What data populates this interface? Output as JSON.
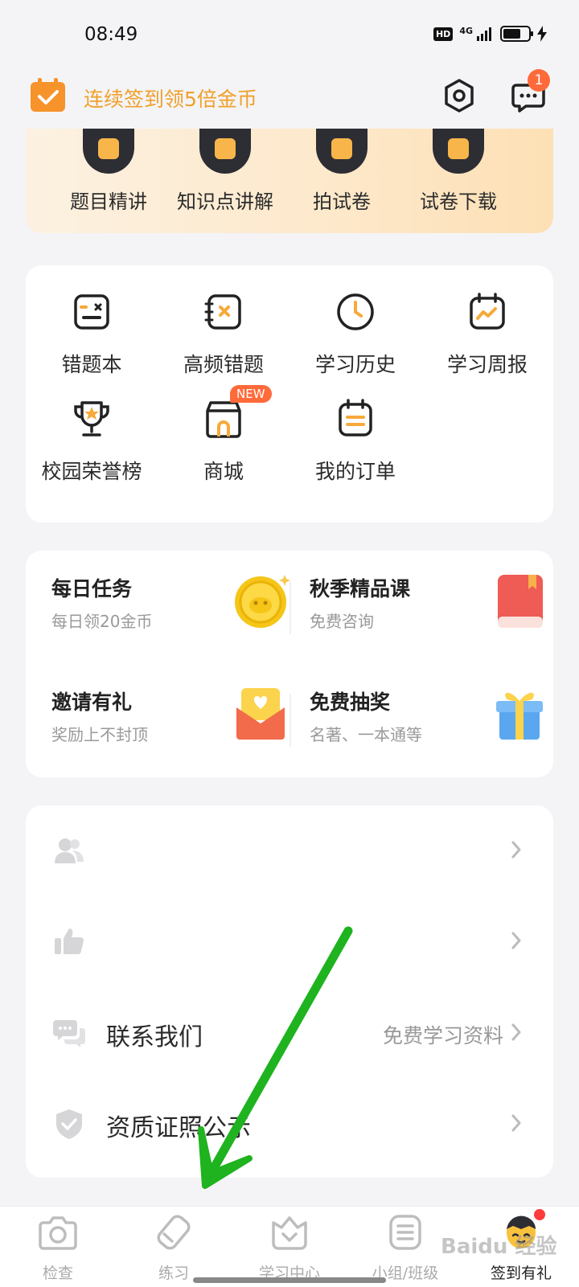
{
  "status": {
    "time": "08:49",
    "hd": "HD",
    "network": "4G"
  },
  "header": {
    "checkin_text": "连续签到领5倍金币",
    "message_badge": "1"
  },
  "promo": {
    "items": [
      {
        "label": "题目精讲",
        "icon": "play-icon"
      },
      {
        "label": "知识点讲解",
        "icon": "notes-icon"
      },
      {
        "label": "拍试卷",
        "icon": "printer-icon"
      },
      {
        "label": "试卷下载",
        "icon": "download-icon"
      }
    ]
  },
  "tools": {
    "items": [
      {
        "label": "错题本",
        "icon": "wrong-book-icon"
      },
      {
        "label": "高频错题",
        "icon": "frequent-mistake-icon"
      },
      {
        "label": "学习历史",
        "icon": "clock-icon"
      },
      {
        "label": "学习周报",
        "icon": "calendar-chart-icon"
      },
      {
        "label": "校园荣誉榜",
        "icon": "trophy-icon"
      },
      {
        "label": "商城",
        "icon": "store-icon",
        "badge": "NEW"
      },
      {
        "label": "我的订单",
        "icon": "order-icon"
      }
    ]
  },
  "tasks": {
    "items": [
      {
        "title": "每日任务",
        "subtitle": "每日领20金币",
        "icon": "coin-icon"
      },
      {
        "title": "秋季精品课",
        "subtitle": "免费咨询",
        "icon": "red-book-icon"
      },
      {
        "title": "邀请有礼",
        "subtitle": "奖励上不封顶",
        "icon": "envelope-icon"
      },
      {
        "title": "免费抽奖",
        "subtitle": "名著、一本通等",
        "icon": "gift-icon"
      }
    ]
  },
  "menu": {
    "rows": [
      {
        "label": "",
        "value": "",
        "icon": "users-icon"
      },
      {
        "label": "",
        "value": "",
        "icon": "thumbs-up-icon"
      },
      {
        "label": "联系我们",
        "value": "免费学习资料",
        "icon": "chat-bubbles-icon"
      },
      {
        "label": "资质证照公示",
        "value": "",
        "icon": "shield-check-icon"
      }
    ]
  },
  "bottom_nav": {
    "items": [
      {
        "label": "检查",
        "icon": "camera-icon"
      },
      {
        "label": "练习",
        "icon": "pencil-eraser-icon"
      },
      {
        "label": "学习中心",
        "icon": "crown-check-icon"
      },
      {
        "label": "小组/班级",
        "icon": "group-list-icon"
      },
      {
        "label": "签到有礼",
        "icon": "mascot-icon",
        "active": true
      }
    ]
  },
  "watermark": "Baidu 经验",
  "colors": {
    "accent": "#f0a02a",
    "badge": "#ff6a3a",
    "arrow": "#1fb31f"
  }
}
